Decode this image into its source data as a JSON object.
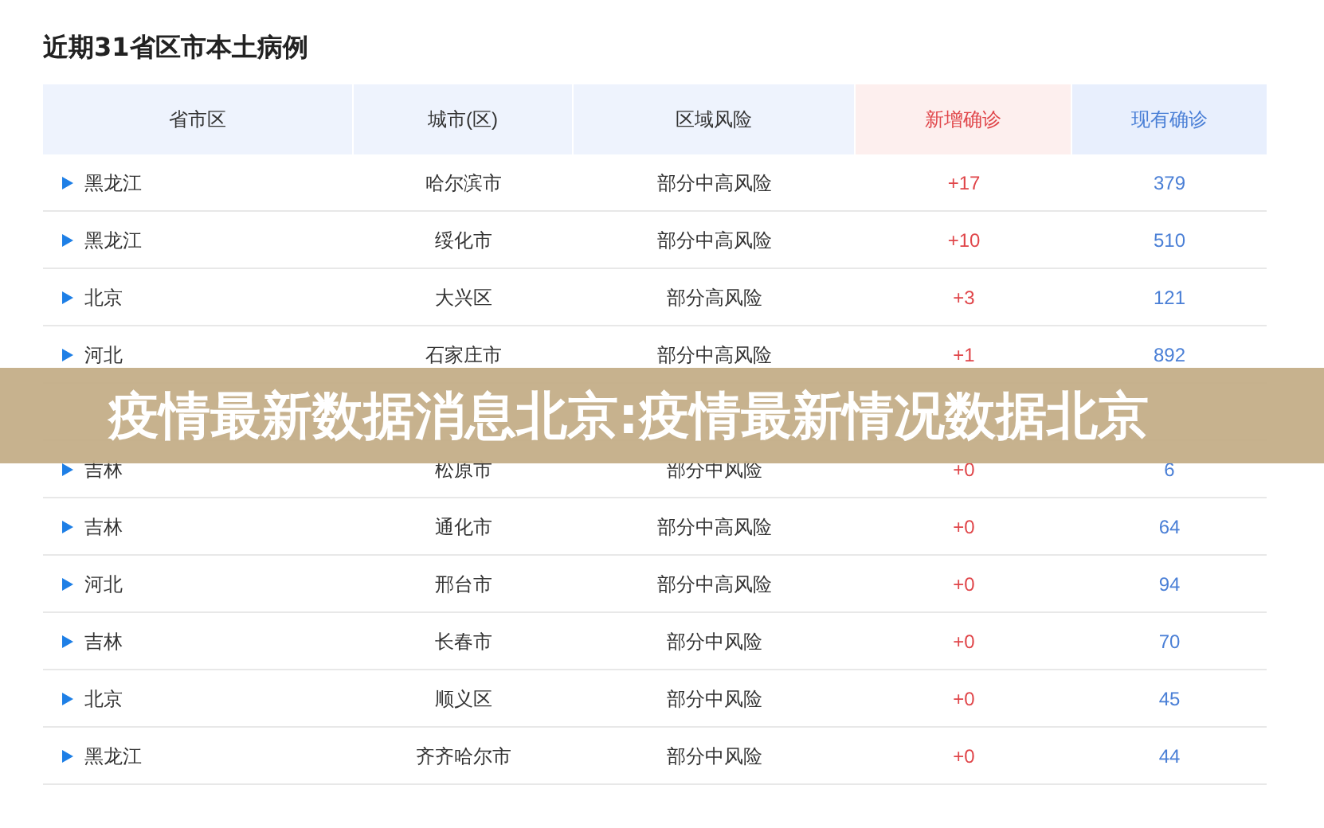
{
  "title": "近期31省区市本土病例",
  "table": {
    "columns": [
      {
        "label": "省市区",
        "kind": "plain"
      },
      {
        "label": "城市(区)",
        "kind": "plain"
      },
      {
        "label": "区域风险",
        "kind": "plain"
      },
      {
        "label": "新增确诊",
        "kind": "new"
      },
      {
        "label": "现有确诊",
        "kind": "current"
      }
    ],
    "rows": [
      {
        "province": "黑龙江",
        "city": "哈尔滨市",
        "risk": "部分中高风险",
        "new": "+17",
        "current": "379"
      },
      {
        "province": "黑龙江",
        "city": "绥化市",
        "risk": "部分中高风险",
        "new": "+10",
        "current": "510"
      },
      {
        "province": "北京",
        "city": "大兴区",
        "risk": "部分高风险",
        "new": "+3",
        "current": "121"
      },
      {
        "province": "河北",
        "city": "石家庄市",
        "risk": "部分中高风险",
        "new": "+1",
        "current": "892"
      },
      {
        "province": "吉林",
        "city": "松原市",
        "risk": "部分中风险",
        "new": "+0",
        "current": "6"
      },
      {
        "province": "吉林",
        "city": "通化市",
        "risk": "部分中高风险",
        "new": "+0",
        "current": "64"
      },
      {
        "province": "河北",
        "city": "邢台市",
        "risk": "部分中高风险",
        "new": "+0",
        "current": "94"
      },
      {
        "province": "吉林",
        "city": "长春市",
        "risk": "部分中风险",
        "new": "+0",
        "current": "70"
      },
      {
        "province": "北京",
        "city": "顺义区",
        "risk": "部分中风险",
        "new": "+0",
        "current": "45"
      },
      {
        "province": "黑龙江",
        "city": "齐齐哈尔市",
        "risk": "部分中风险",
        "new": "+0",
        "current": "44"
      }
    ]
  },
  "banner": {
    "text": "疫情最新数据消息北京:疫情最新情况数据北京"
  }
}
